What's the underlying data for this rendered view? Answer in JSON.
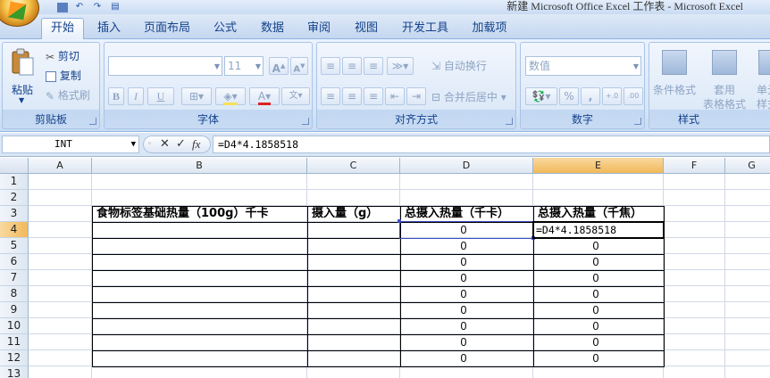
{
  "window": {
    "title": "新建 Microsoft Office Excel 工作表 - Microsoft Excel"
  },
  "tabs": [
    {
      "label": "开始",
      "active": true
    },
    {
      "label": "插入"
    },
    {
      "label": "页面布局"
    },
    {
      "label": "公式"
    },
    {
      "label": "数据"
    },
    {
      "label": "审阅"
    },
    {
      "label": "视图"
    },
    {
      "label": "开发工具"
    },
    {
      "label": "加载项"
    }
  ],
  "ribbon": {
    "clipboard": {
      "label": "剪贴板",
      "paste": "粘贴",
      "cut": "剪切",
      "copy": "复制",
      "format_painter": "格式刷"
    },
    "font": {
      "label": "字体",
      "font_name": "",
      "font_size": "11",
      "bold": "B",
      "italic": "I",
      "underline": "U"
    },
    "alignment": {
      "label": "对齐方式",
      "wrap_text": "自动换行",
      "merge_center": "合并后居中"
    },
    "number": {
      "label": "数字",
      "format": "数值",
      "percent": "%",
      "comma": ","
    },
    "styles": {
      "label": "样式",
      "conditional_format": "条件格式",
      "table_format_1": "套用",
      "table_format_2": "表格格式",
      "cell_styles_1": "单元",
      "cell_styles_2": "样式"
    }
  },
  "formula_bar": {
    "name_box": "INT",
    "formula": "=D4*4.1858518",
    "cancel_icon": "✕",
    "enter_icon": "✓",
    "fx": "fx"
  },
  "sheet": {
    "columns": [
      "A",
      "B",
      "C",
      "D",
      "E",
      "F",
      "G"
    ],
    "rows": [
      "1",
      "2",
      "3",
      "4",
      "5",
      "6",
      "7",
      "8",
      "9",
      "10",
      "11",
      "12",
      "13"
    ],
    "selected_column": "E",
    "selected_row": "4",
    "headers": {
      "B3": "食物标签基础热量（100g）千卡",
      "C3": "摄入量（g）",
      "D3": "总摄入热量（千卡）",
      "E3": "总摄入热量（千焦）"
    },
    "d_values": [
      "0",
      "0",
      "0",
      "0",
      "0",
      "0",
      "0",
      "0",
      "0"
    ],
    "e_values": [
      "=D4*4.1858518",
      "0",
      "0",
      "0",
      "0",
      "0",
      "0",
      "0",
      "0"
    ]
  },
  "colors": {
    "accent": "#15428b",
    "selected_header": "#f1b95a",
    "ref_border": "#3a4cc0"
  }
}
